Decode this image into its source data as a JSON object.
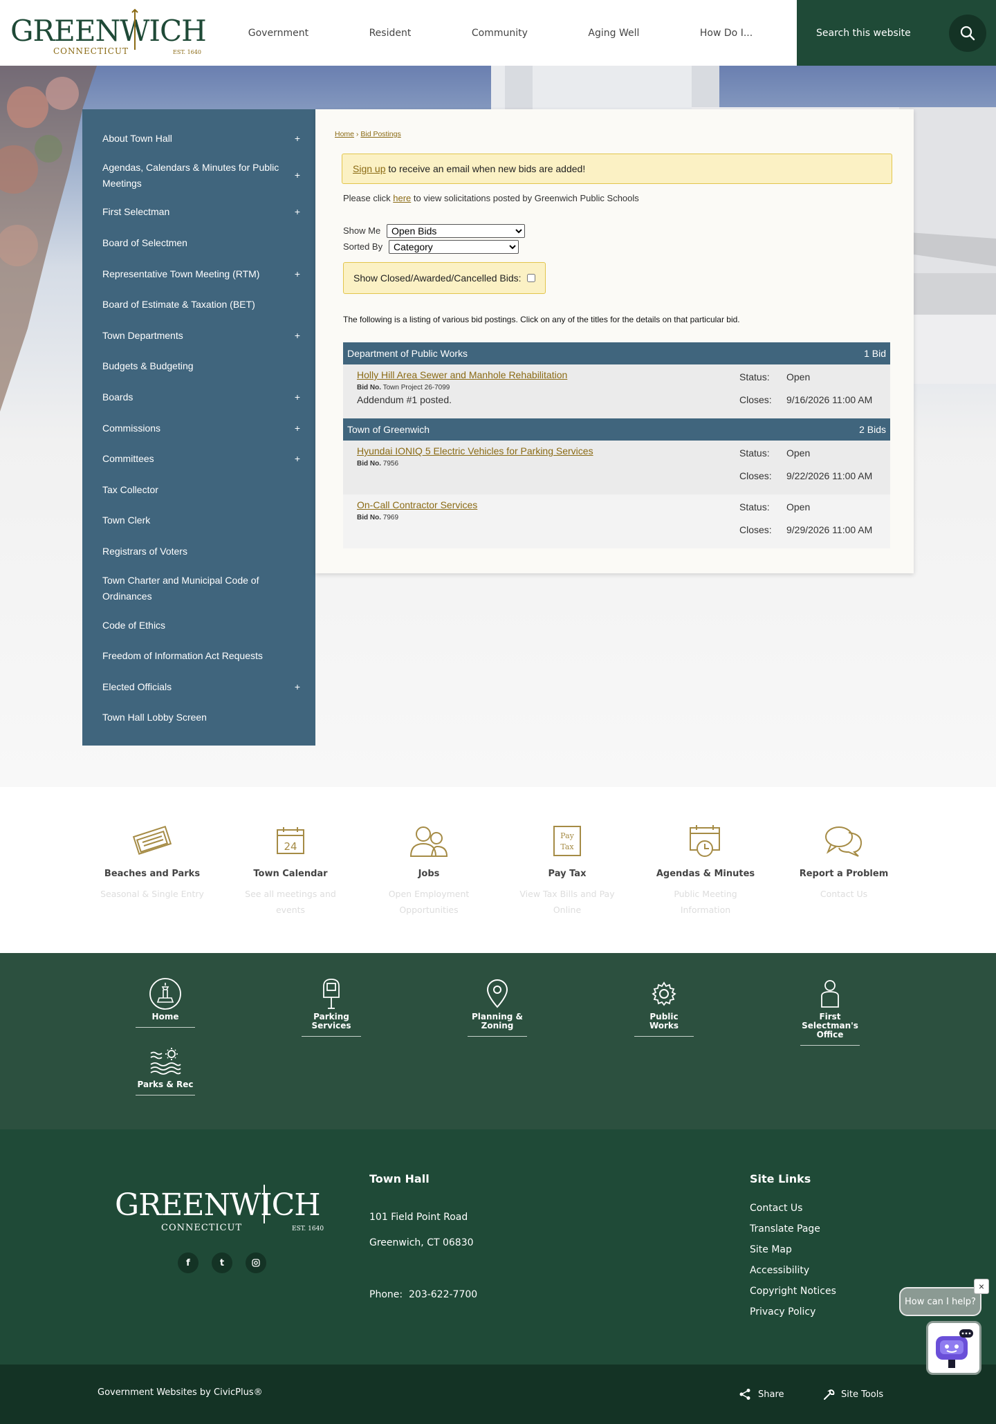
{
  "header": {
    "logo": {
      "name": "GREENWICH",
      "sub": "CONNECTICUT",
      "est": "EST. 1640"
    },
    "nav": [
      "Government",
      "Resident",
      "Community",
      "Aging Well",
      "How Do I..."
    ],
    "search_placeholder": "Search this website"
  },
  "sidebar": {
    "items": [
      {
        "label": "About Town Hall",
        "expand": "+"
      },
      {
        "label": "Agendas, Calendars & Minutes for Public Meetings",
        "expand": "+"
      },
      {
        "label": "First Selectman",
        "expand": "+"
      },
      {
        "label": "Board of Selectmen",
        "expand": ""
      },
      {
        "label": "Representative Town Meeting (RTM)",
        "expand": "+"
      },
      {
        "label": "Board of Estimate & Taxation (BET)",
        "expand": ""
      },
      {
        "label": "Town Departments",
        "expand": "+"
      },
      {
        "label": "Budgets & Budgeting",
        "expand": ""
      },
      {
        "label": "Boards",
        "expand": "+"
      },
      {
        "label": "Commissions",
        "expand": "+"
      },
      {
        "label": "Committees",
        "expand": "+"
      },
      {
        "label": "Tax Collector",
        "expand": ""
      },
      {
        "label": "Town Clerk",
        "expand": ""
      },
      {
        "label": "Registrars of Voters",
        "expand": ""
      },
      {
        "label": "Town Charter and Municipal Code of Ordinances",
        "expand": ""
      },
      {
        "label": "Code of Ethics",
        "expand": ""
      },
      {
        "label": "Freedom of Information Act Requests",
        "expand": ""
      },
      {
        "label": "Elected Officials",
        "expand": "+"
      },
      {
        "label": "Town Hall Lobby Screen",
        "expand": ""
      }
    ]
  },
  "content": {
    "breadcrumb": {
      "home": "Home",
      "sep": " › ",
      "current": "Bid Postings"
    },
    "alert": {
      "link": "Sign up",
      "text": " to receive an email when new bids are added!"
    },
    "note": {
      "before": "Please click ",
      "link": "here",
      "after": " to view solicitations posted by Greenwich Public Schools"
    },
    "show_me": {
      "label": "Show Me",
      "value": "Open Bids"
    },
    "sorted_by": {
      "label": "Sorted By",
      "value": "Category"
    },
    "closed_label": "Show Closed/Awarded/Cancelled Bids:",
    "intro": "The following is a listing of various bid postings. Click on any of the titles for the details on that particular bid.",
    "categories": [
      {
        "name": "Department of Public Works",
        "count": "1 Bid",
        "bids": [
          {
            "title": "Holly Hill Area Sewer and Manhole Rehabilitation",
            "bid_no_label": "Bid No.",
            "bid_no": "Town Project 26-7099",
            "addendum": "Addendum #1 posted.",
            "status_label": "Status:",
            "status": "Open",
            "closes_label": "Closes:",
            "closes": "9/16/2026 11:00 AM"
          }
        ]
      },
      {
        "name": "Town of Greenwich",
        "count": "2 Bids",
        "bids": [
          {
            "title": "Hyundai IONIQ 5 Electric Vehicles for Parking Services",
            "bid_no_label": "Bid No.",
            "bid_no": "7956",
            "addendum": "",
            "status_label": "Status:",
            "status": "Open",
            "closes_label": "Closes:",
            "closes": "9/22/2026 11:00 AM"
          },
          {
            "title": "On-Call Contractor Services",
            "bid_no_label": "Bid No.",
            "bid_no": "7969",
            "addendum": "",
            "status_label": "Status:",
            "status": "Open",
            "closes_label": "Closes:",
            "closes": "9/29/2026 11:00 AM"
          }
        ]
      }
    ]
  },
  "quick_links": [
    {
      "title": "Beaches and Parks",
      "desc": "Seasonal & Single Entry",
      "icon": "tickets-icon"
    },
    {
      "title": "Town Calendar",
      "desc": "See all meetings and events",
      "icon": "calendar-icon",
      "icon_text": "24"
    },
    {
      "title": "Jobs",
      "desc": "Open Employment Opportunities",
      "icon": "people-icon"
    },
    {
      "title": "Pay Tax",
      "desc": "View Tax Bills and Pay Online",
      "icon": "pay-tax-icon",
      "icon_text": "Pay Tax"
    },
    {
      "title": "Agendas & Minutes",
      "desc": "Public Meeting Information",
      "icon": "calendar-clock-icon"
    },
    {
      "title": "Report a Problem",
      "desc": "Contact Us",
      "icon": "chat-bubbles-icon"
    }
  ],
  "icon_bar": [
    {
      "label": "Home",
      "icon": "town-hall-icon"
    },
    {
      "label": "Parking Services",
      "icon": "parking-meter-icon"
    },
    {
      "label": "Planning & Zoning",
      "icon": "map-pin-icon"
    },
    {
      "label": "Public Works",
      "icon": "gear-icon"
    },
    {
      "label": "First Selectman's Office",
      "icon": "person-icon"
    },
    {
      "label": "Parks & Rec",
      "icon": "waves-sun-icon"
    }
  ],
  "footer": {
    "town_hall": {
      "title": "Town Hall",
      "address1": "101 Field Point Road",
      "address2": "Greenwich, CT 06830",
      "phone_label": "Phone:",
      "phone": "203-622-7700"
    },
    "site_links": {
      "title": "Site Links",
      "links": [
        "Contact Us",
        "Translate Page",
        "Site Map",
        "Accessibility",
        "Copyright Notices",
        "Privacy Policy"
      ]
    },
    "social": [
      "f",
      "t",
      "ig"
    ]
  },
  "bottom": {
    "credit": "Government Websites by CivicPlus®",
    "share": "Share",
    "site_tools": "Site Tools"
  },
  "chat": {
    "prompt": "How can I help?",
    "close": "×"
  },
  "colors": {
    "header_green": "#1f4a37",
    "sidebar_blue": "#40657d",
    "gold": "#8a6a14",
    "alert_yellow": "#fbf1c4",
    "iconbar_green": "#2c503f"
  }
}
